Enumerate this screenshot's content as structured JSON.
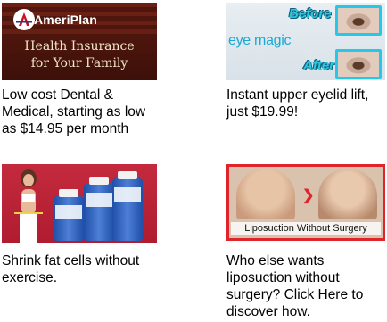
{
  "ads": [
    {
      "id": "ameriplan",
      "brand": "AmeriPlan",
      "tagline_line1": "Health Insurance",
      "tagline_line2": "for Your Family",
      "text": "Low cost Dental & Medical, starting as low as $14.95 per month"
    },
    {
      "id": "eye-magic",
      "before_label": "Before",
      "after_label": "After",
      "logo_text": "eye magic",
      "text": "Instant upper eyelid lift, just $19.99!"
    },
    {
      "id": "shrink-fat",
      "text": "Shrink fat cells without exercise."
    },
    {
      "id": "liposuction",
      "caption": "Liposuction Without Surgery",
      "text": "Who else wants liposuction without surgery? Click Here to discover how."
    }
  ],
  "colors": {
    "ameriplan_bg": "#4a140c",
    "eye_accent": "#24c8e8",
    "fat_bg": "#c42a3d",
    "lipo_border": "#e0242b"
  }
}
